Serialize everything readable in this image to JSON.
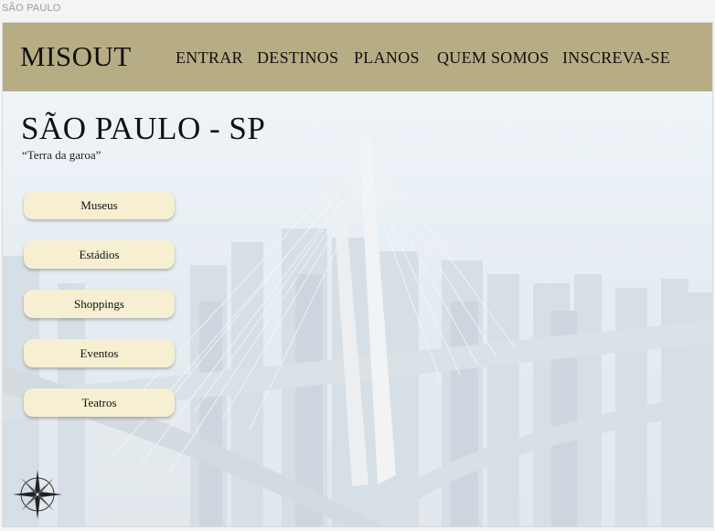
{
  "tab": {
    "title": "SÃO PAULO"
  },
  "navbar": {
    "logo": "MISOUT",
    "items": [
      "ENTRAR",
      "DESTINOS",
      "PLANOS",
      "QUEM SOMOS",
      "INSCREVA-SE"
    ]
  },
  "hero": {
    "title": "SÃO PAULO - SP",
    "subtitle": "“Terra da garoa”",
    "categories": [
      "Museus",
      "Estádios",
      "Shoppings",
      "Eventos",
      "Teatros"
    ]
  },
  "icons": {
    "compass": "compass-rose-icon"
  },
  "colors": {
    "navbar": "#b6ad84",
    "button": "#f6efd2"
  }
}
